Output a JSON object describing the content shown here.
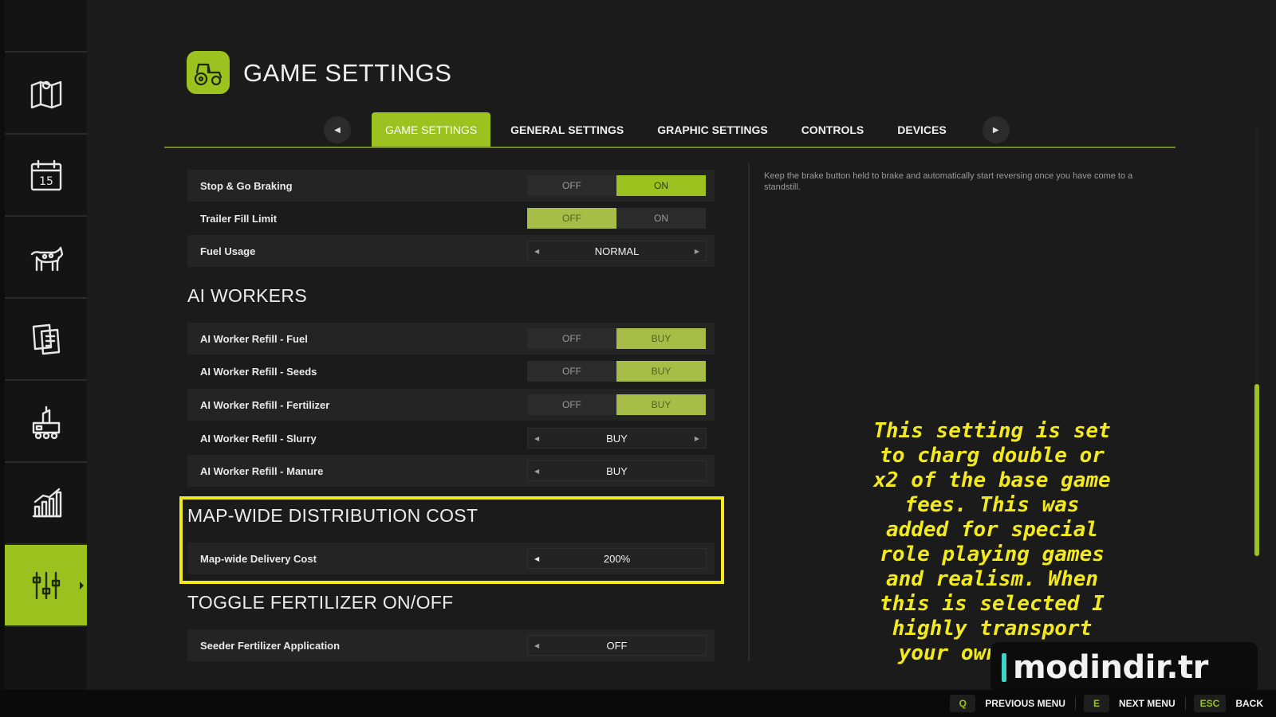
{
  "sidebar": {
    "items": [
      {
        "icon": "map-icon"
      },
      {
        "icon": "calendar-icon",
        "day": "15"
      },
      {
        "icon": "livestock-icon"
      },
      {
        "icon": "contracts-icon"
      },
      {
        "icon": "production-icon"
      },
      {
        "icon": "statistics-icon"
      },
      {
        "icon": "settings-sliders-icon",
        "active": true
      }
    ]
  },
  "header": {
    "title": "GAME SETTINGS",
    "icon": "tractor-icon"
  },
  "tabs": [
    {
      "label": "GAME SETTINGS",
      "active": true
    },
    {
      "label": "GENERAL SETTINGS"
    },
    {
      "label": "GRAPHIC SETTINGS"
    },
    {
      "label": "CONTROLS"
    },
    {
      "label": "DEVICES"
    }
  ],
  "settings": {
    "stop_go_braking": {
      "label": "Stop & Go Braking",
      "off": "OFF",
      "on": "ON",
      "value": "ON"
    },
    "trailer_fill_limit": {
      "label": "Trailer Fill Limit",
      "off": "OFF",
      "on": "ON",
      "value": "OFF"
    },
    "fuel_usage": {
      "label": "Fuel Usage",
      "value": "NORMAL"
    }
  },
  "ai_workers": {
    "title": "AI WORKERS",
    "fuel": {
      "label": "AI Worker Refill - Fuel",
      "off": "OFF",
      "on": "BUY",
      "value": "BUY"
    },
    "seeds": {
      "label": "AI Worker Refill - Seeds",
      "off": "OFF",
      "on": "BUY",
      "value": "BUY"
    },
    "fertilizer": {
      "label": "AI Worker Refill - Fertilizer",
      "off": "OFF",
      "on": "BUY",
      "value": "BUY"
    },
    "slurry": {
      "label": "AI Worker Refill - Slurry",
      "value": "BUY"
    },
    "manure": {
      "label": "AI Worker Refill - Manure",
      "value": "BUY"
    }
  },
  "distribution": {
    "title": "MAP-WIDE DISTRIBUTION COST",
    "delivery_cost": {
      "label": "Map-wide Delivery Cost",
      "value": "200%"
    }
  },
  "fertilizer_toggle": {
    "title": "TOGGLE FERTILIZER ON/OFF",
    "seeder": {
      "label": "Seeder Fertilizer Application",
      "value": "OFF"
    }
  },
  "description": "Keep the brake button held to brake and automatically start reversing once you have come to a standstill.",
  "caption": "This setting is set\nto charg double or\nx2 of the base game\nfees. This was\nadded for special\nrole playing games\nand realism.  When\nthis is selected I\nhighly transport\nyour own goods.",
  "watermark": "modindir.tr",
  "footer": {
    "prev": {
      "key": "Q",
      "label": "PREVIOUS MENU"
    },
    "next": {
      "key": "E",
      "label": "NEXT MENU"
    },
    "back": {
      "key": "ESC",
      "label": "BACK"
    }
  },
  "colors": {
    "accent": "#9bc21f",
    "highlight": "#f2ea1e",
    "background": "#1b1b1b"
  }
}
